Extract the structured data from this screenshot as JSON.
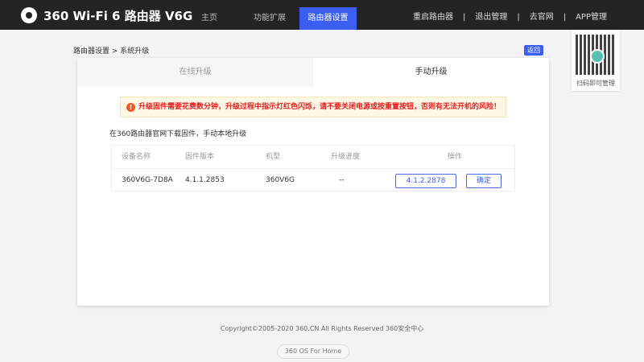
{
  "header": {
    "brand": "360 Wi-Fi 6 路由器 V6G",
    "nav": [
      "主页",
      "功能扩展",
      "路由器设置"
    ],
    "active_nav": "路由器设置",
    "right_links": [
      "重启路由器",
      "退出管理",
      "去官网",
      "APP管理"
    ],
    "separator": "|"
  },
  "qr": {
    "caption": "扫码即可管理"
  },
  "breadcrumb": "路由器设置 > 系统升级",
  "back_label": "返回",
  "tabs": [
    "在线升级",
    "手动升级"
  ],
  "warning": "升级固件需要花费数分钟，升级过程中指示灯红色闪烁，请不要关闭电源或按重置按钮，否则有无法开机的风险！",
  "description": "在360路由器官网下载固件，手动本地升级",
  "table": {
    "headers": [
      "设备名称",
      "固件版本",
      "机型",
      "升级进度",
      "操作"
    ],
    "row": {
      "device": "360V6G-7D8A",
      "firmware": "4.1.1.2853",
      "model": "360V6G",
      "progress": "--",
      "file": "4.1.2.2878",
      "confirm": "确定"
    }
  },
  "footer": {
    "copyright": "Copyright©2005-2020 360.CN All Rights Reserved 360安全中心",
    "os": "360 OS For Home"
  }
}
